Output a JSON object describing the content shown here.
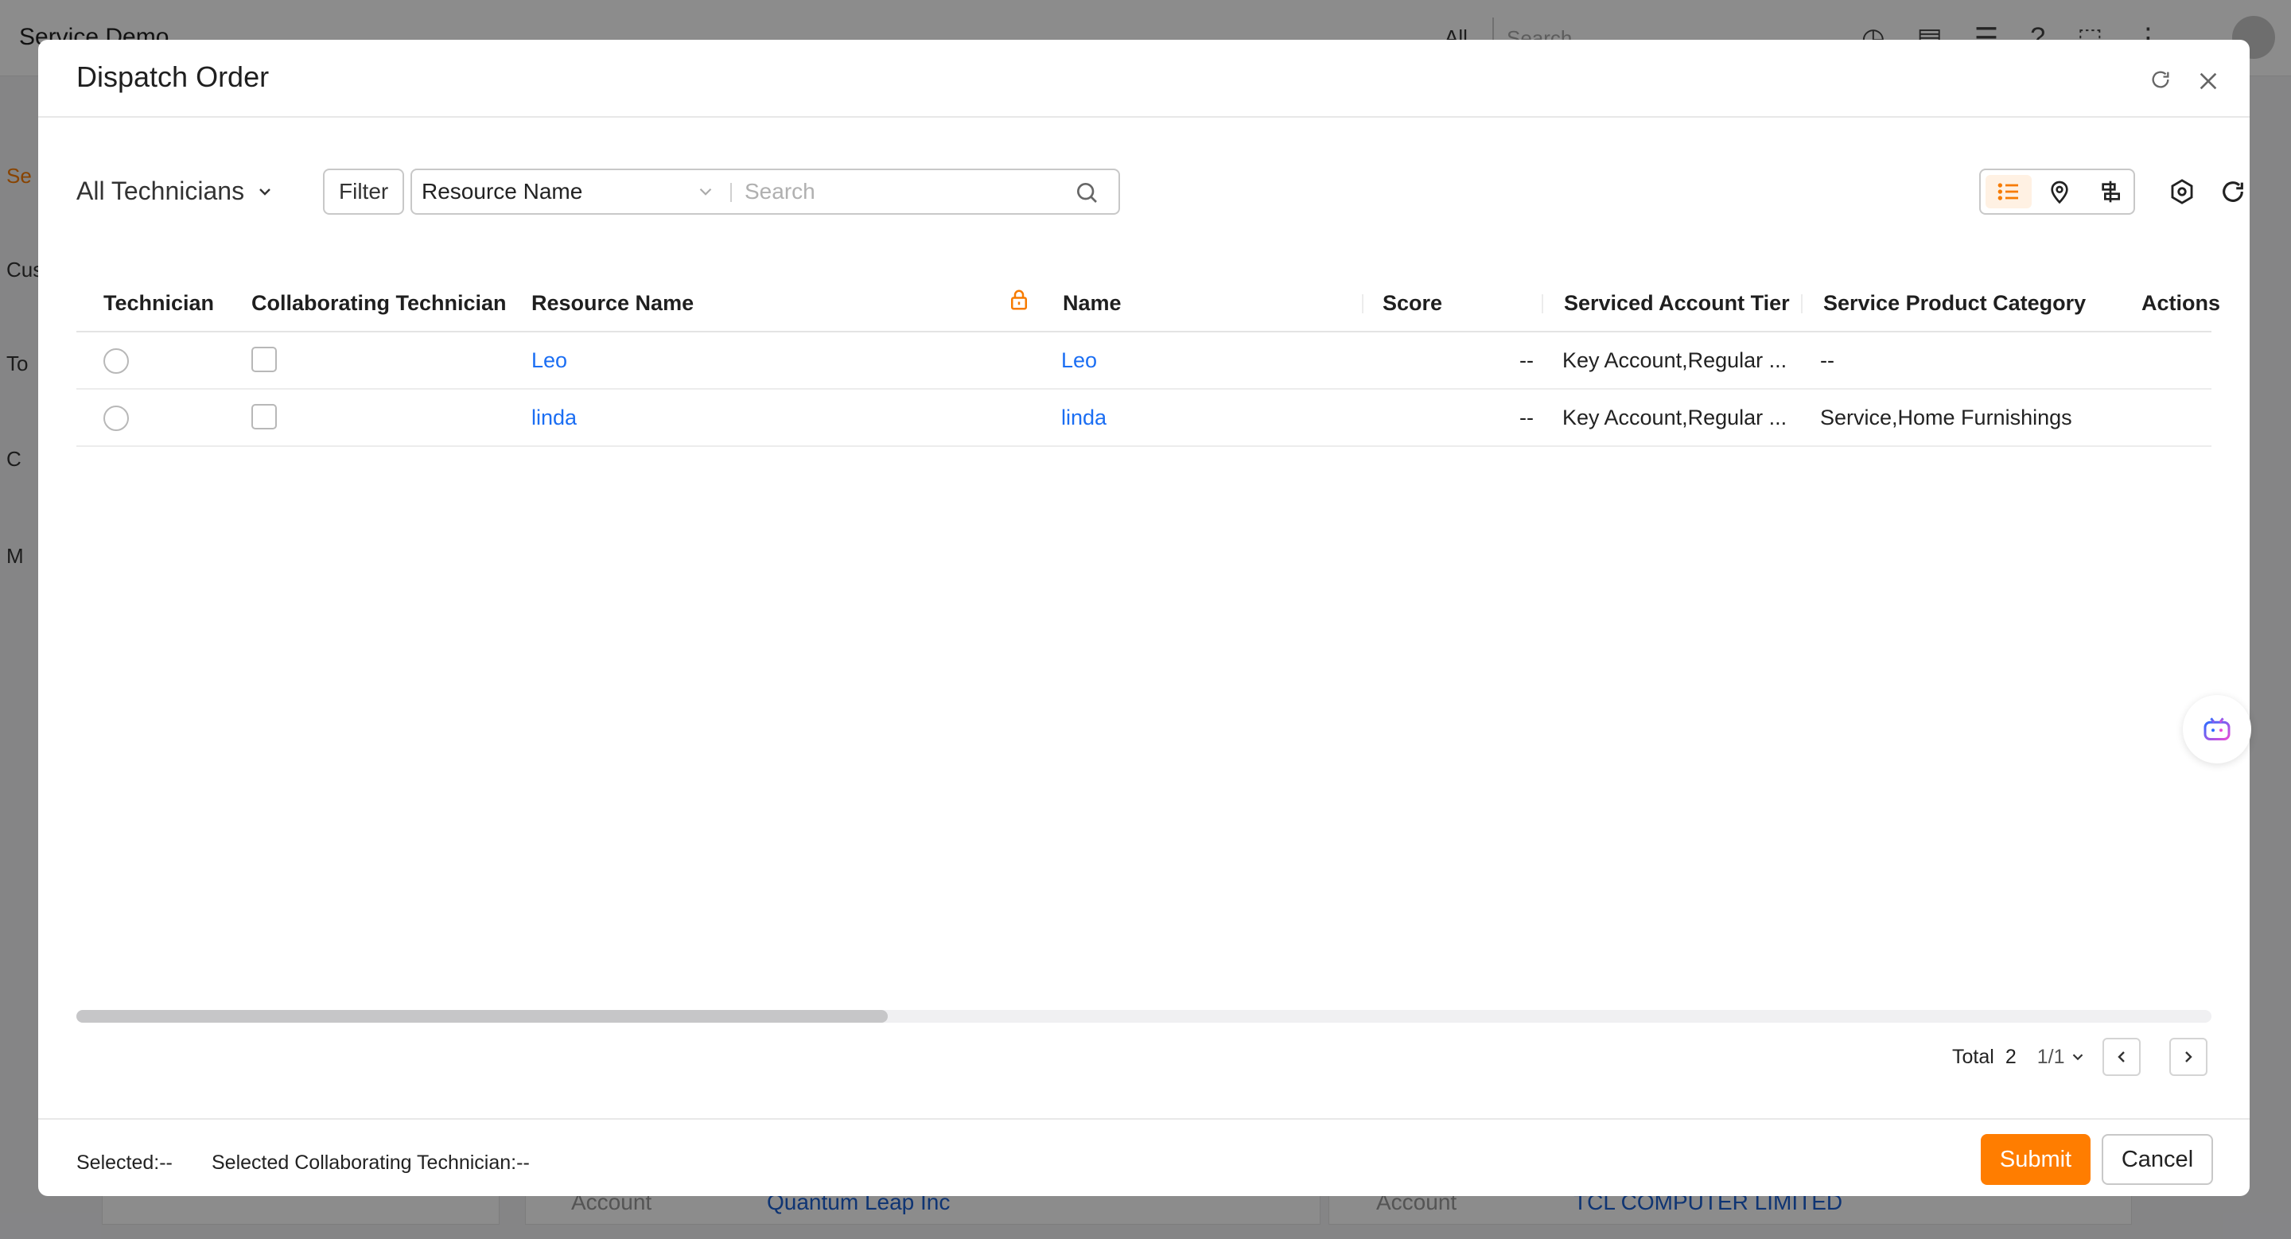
{
  "background": {
    "app_title": "Service Demo",
    "scope": "All",
    "search_placeholder": "Search",
    "sidebar_items": [
      "Se",
      "Cus",
      "To",
      "C",
      "M"
    ],
    "cards": [
      {
        "label": "Account",
        "value": "Quantum Leap Inc"
      },
      {
        "label": "Account",
        "value": "TCL COMPUTER LIMITED"
      }
    ]
  },
  "modal": {
    "title": "Dispatch Order",
    "toolbar": {
      "technician_scope": "All Technicians",
      "filter_label": "Filter",
      "search_field": "Resource Name",
      "search_placeholder": "Search"
    },
    "table": {
      "columns": [
        "Technician",
        "Collaborating Technician",
        "Resource Name",
        "Name",
        "Score",
        "Serviced Account Tier",
        "Service Product Category",
        "Actions"
      ],
      "rows": [
        {
          "resource_name": "Leo",
          "name": "Leo",
          "score": "--",
          "tier": "Key Account,Regular ...",
          "category": "--"
        },
        {
          "resource_name": "linda",
          "name": "linda",
          "score": "--",
          "tier": "Key Account,Regular ...",
          "category": "Service,Home Furnishings"
        }
      ]
    },
    "pagination": {
      "total_label": "Total",
      "total": "2",
      "page": "1/1"
    },
    "footer": {
      "selected": "Selected:--",
      "selected_collab": "Selected Collaborating Technician:--",
      "submit": "Submit",
      "cancel": "Cancel"
    }
  },
  "colors": {
    "accent": "#ff7d00",
    "link": "#1b6ef3",
    "active_view_bg": "#fff1e3"
  },
  "icons": [
    "refresh-icon",
    "close-icon",
    "chevron-down-icon",
    "search-icon",
    "list-view-icon",
    "map-pin-icon",
    "gantt-view-icon",
    "settings-icon",
    "reload-icon",
    "lock-icon",
    "chevron-left-icon",
    "chevron-right-icon",
    "ai-assistant-icon"
  ]
}
